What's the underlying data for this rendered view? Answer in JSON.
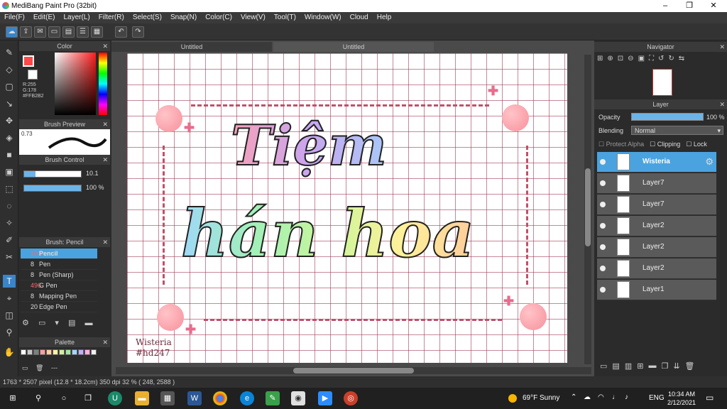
{
  "app": {
    "title": "MediBang Paint Pro (32bit)",
    "minimize": "–",
    "maximize": "❐",
    "close": "✕"
  },
  "menu": [
    "File(F)",
    "Edit(E)",
    "Layer(L)",
    "Filter(R)",
    "Select(S)",
    "Snap(N)",
    "Color(C)",
    "View(V)",
    "Tool(T)",
    "Window(W)",
    "Cloud",
    "Help"
  ],
  "toolbar": {
    "undo": "↶",
    "redo": "↷"
  },
  "tabs": [
    "Untitled",
    "Untitled"
  ],
  "color_panel": {
    "title": "Color",
    "r": "R:255",
    "g": "G:178",
    "b": "B:178",
    "hex": "#FFB2B2",
    "primary_color": "#ff4848",
    "hue_color": "#ff1f1f"
  },
  "brush_preview": {
    "title": "Brush Preview",
    "size": "0.73"
  },
  "brush_control": {
    "title": "Brush Control",
    "size": "10.1",
    "opacity": "100 %",
    "opacity_level": 1.0
  },
  "brush_list": {
    "title": "Brush: Pencil",
    "items": [
      {
        "size": "10.1",
        "name": "Pencil",
        "color": "#2a2a2a"
      },
      {
        "size": "8",
        "name": "Pen",
        "color": "#2a2a2a"
      },
      {
        "size": "8",
        "name": "Pen (Sharp)",
        "color": "#2a2a2a"
      },
      {
        "size": "496",
        "name": "G Pen",
        "color": "#e03030"
      },
      {
        "size": "8",
        "name": "Mapping Pen",
        "color": "#e03030"
      },
      {
        "size": "20",
        "name": "Edge Pen",
        "color": "#e03030"
      }
    ]
  },
  "palette": {
    "title": "Palette",
    "footer": "---",
    "swatches": [
      "#ffffff",
      "#c8c8c8",
      "#7f7f7f",
      "#ff9f9f",
      "#ffd0a0",
      "#fff2a0",
      "#d0f0a0",
      "#a0e8a0",
      "#a0d8ff",
      "#c0b0ff",
      "#ffb0e0",
      "#f0f0f0"
    ]
  },
  "canvas": {
    "title_line1": "Tiệm",
    "title_line2": "hán hoa",
    "signature1": "Wisteria",
    "signature2": "#hd247"
  },
  "navigator": {
    "title": "Navigator"
  },
  "layer_panel": {
    "title": "Layer",
    "opacity_label": "Opacity",
    "opacity_value": "100 %",
    "blending_label": "Blending",
    "blending_value": "Normal",
    "protect_alpha": "Protect Alpha",
    "clipping": "Clipping",
    "lock": "Lock",
    "layers": [
      "Wisteria",
      "Layer7",
      "Layer7",
      "Layer2",
      "Layer2",
      "Layer2",
      "Layer1"
    ]
  },
  "status": {
    "text": "1763 * 2507 pixel   (12.8 * 18.2cm)   350 dpi   32 %   ( 248, 2588 )"
  },
  "taskbar": {
    "temp": "69°F",
    "weather": "Sunny",
    "lang": "ENG",
    "time": "10:34 AM",
    "date": "2/12/2021"
  }
}
